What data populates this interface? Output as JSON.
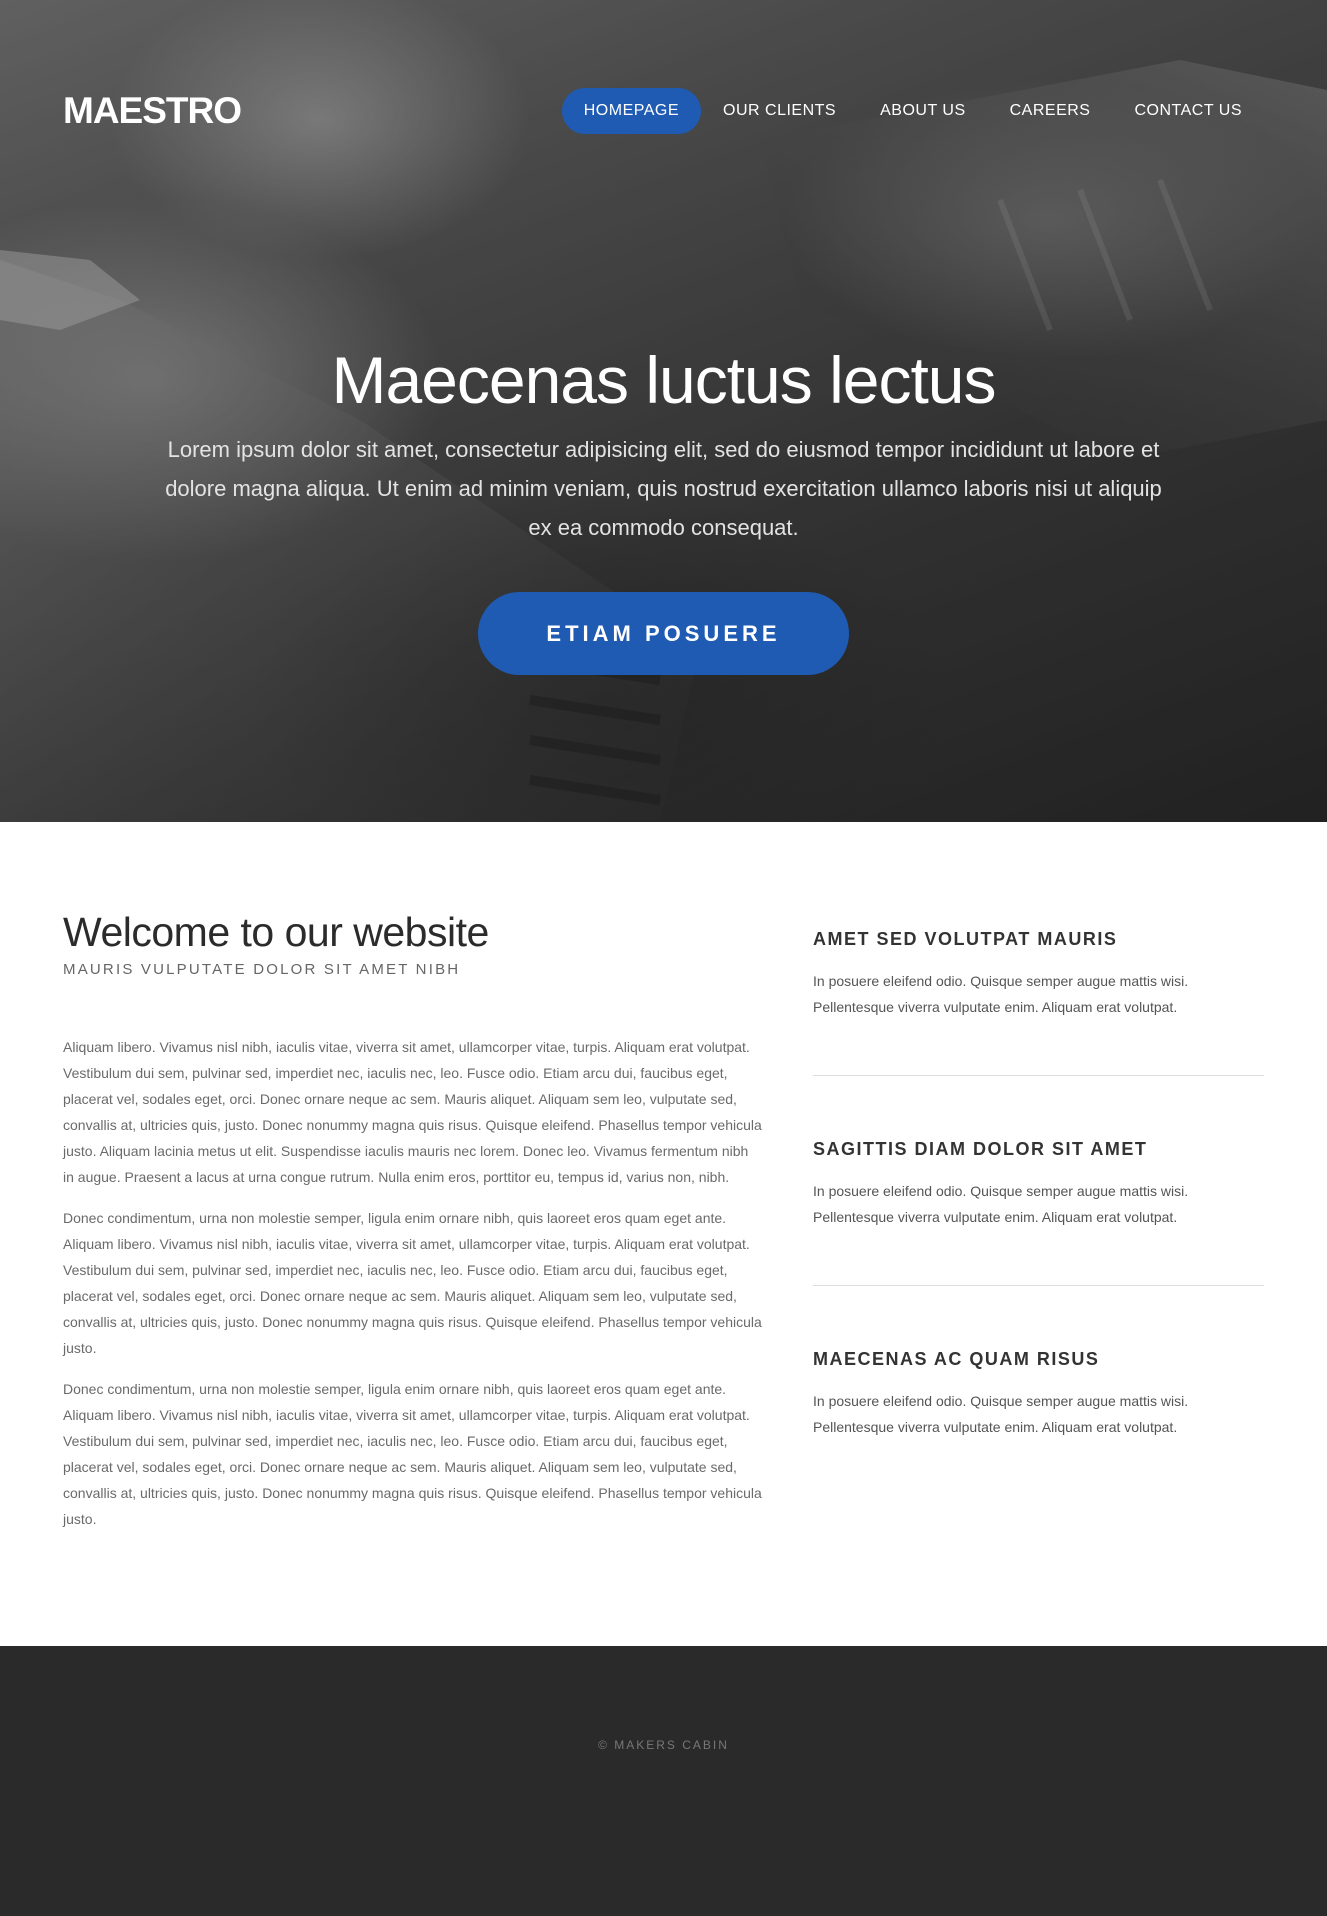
{
  "brand": {
    "logo": "MAESTRO"
  },
  "nav": {
    "items": [
      {
        "label": "HOMEPAGE",
        "active": true
      },
      {
        "label": "OUR CLIENTS",
        "active": false
      },
      {
        "label": "ABOUT US",
        "active": false
      },
      {
        "label": "CAREERS",
        "active": false
      },
      {
        "label": "CONTACT US",
        "active": false
      }
    ]
  },
  "hero": {
    "title": "Maecenas luctus lectus",
    "text": "Lorem ipsum dolor sit amet, consectetur adipisicing elit, sed do eiusmod tempor incididunt ut labore et dolore magna aliqua. Ut enim ad minim veniam, quis nostrud exercitation ullamco laboris nisi ut aliquip ex ea commodo consequat.",
    "cta_label": "ETIAM POSUERE"
  },
  "main": {
    "title": "Welcome to our website",
    "subtitle": "MAURIS VULPUTATE DOLOR SIT AMET NIBH",
    "paragraphs": [
      "Aliquam libero. Vivamus nisl nibh, iaculis vitae, viverra sit amet, ullamcorper vitae, turpis. Aliquam erat volutpat. Vestibulum dui sem, pulvinar sed, imperdiet nec, iaculis nec, leo. Fusce odio. Etiam arcu dui, faucibus eget, placerat vel, sodales eget, orci. Donec ornare neque ac sem. Mauris aliquet. Aliquam sem leo, vulputate sed, convallis at, ultricies quis, justo. Donec nonummy magna quis risus. Quisque eleifend. Phasellus tempor vehicula justo. Aliquam lacinia metus ut elit. Suspendisse iaculis mauris nec lorem. Donec leo. Vivamus fermentum nibh in augue. Praesent a lacus at urna congue rutrum. Nulla enim eros, porttitor eu, tempus id, varius non, nibh.",
      "Donec condimentum, urna non molestie semper, ligula enim ornare nibh, quis laoreet eros quam eget ante. Aliquam libero. Vivamus nisl nibh, iaculis vitae, viverra sit amet, ullamcorper vitae, turpis. Aliquam erat volutpat. Vestibulum dui sem, pulvinar sed, imperdiet nec, iaculis nec, leo. Fusce odio. Etiam arcu dui, faucibus eget, placerat vel, sodales eget, orci. Donec ornare neque ac sem. Mauris aliquet. Aliquam sem leo, vulputate sed, convallis at, ultricies quis, justo. Donec nonummy magna quis risus. Quisque eleifend. Phasellus tempor vehicula justo.",
      "Donec condimentum, urna non molestie semper, ligula enim ornare nibh, quis laoreet eros quam eget ante. Aliquam libero. Vivamus nisl nibh, iaculis vitae, viverra sit amet, ullamcorper vitae, turpis. Aliquam erat volutpat. Vestibulum dui sem, pulvinar sed, imperdiet nec, iaculis nec, leo. Fusce odio. Etiam arcu dui, faucibus eget, placerat vel, sodales eget, orci. Donec ornare neque ac sem. Mauris aliquet. Aliquam sem leo, vulputate sed, convallis at, ultricies quis, justo. Donec nonummy magna quis risus. Quisque eleifend. Phasellus tempor vehicula justo."
    ]
  },
  "sidebar": {
    "items": [
      {
        "title": "AMET SED VOLUTPAT MAURIS",
        "text": "In posuere eleifend odio. Quisque semper augue mattis wisi. Pellentesque viverra vulputate enim. Aliquam erat volutpat."
      },
      {
        "title": "SAGITTIS DIAM DOLOR SIT AMET",
        "text": "In posuere eleifend odio. Quisque semper augue mattis wisi. Pellentesque viverra vulputate enim. Aliquam erat volutpat."
      },
      {
        "title": "MAECENAS AC QUAM RISUS",
        "text": "In posuere eleifend odio. Quisque semper augue mattis wisi. Pellentesque viverra vulputate enim. Aliquam erat volutpat."
      }
    ]
  },
  "footer": {
    "text": "© MAKERS CABIN"
  },
  "colors": {
    "accent": "#1f5bb3",
    "footer_bg": "#2a2a2a",
    "heading": "#2b2b2b",
    "body_text": "#6a6a6a"
  },
  "icons": {
    "hero_background": "photo-background"
  }
}
